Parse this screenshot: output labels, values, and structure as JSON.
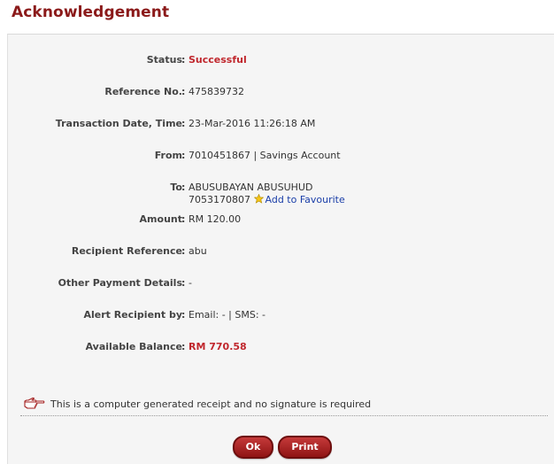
{
  "page": {
    "title": "Acknowledgement"
  },
  "colon": ":",
  "fields": {
    "status": {
      "label": "Status",
      "value": "Successful"
    },
    "reference_no": {
      "label": "Reference No.",
      "value": "475839732"
    },
    "transaction_date": {
      "label": "Transaction Date, Time",
      "value": "23-Mar-2016 11:26:18 AM"
    },
    "from": {
      "label": "From",
      "value": "7010451867 | Savings Account"
    },
    "to": {
      "label": "To",
      "name": "ABUSUBAYAN ABUSUHUD",
      "account": "7053170807",
      "favourite_link": "Add to Favourite",
      "favourite_icon": "star-icon"
    },
    "amount": {
      "label": "Amount",
      "value": "RM 120.00"
    },
    "recipient_reference": {
      "label": "Recipient Reference",
      "value": "abu"
    },
    "other_payment_details": {
      "label": "Other Payment Details",
      "value": "-"
    },
    "alert_recipient": {
      "label": "Alert Recipient by",
      "value": "Email: - | SMS: -"
    },
    "available_balance": {
      "label": "Available Balance",
      "value": "RM 770.58"
    }
  },
  "note": {
    "icon": "pointing-hand-icon",
    "text": "This is a computer generated receipt and no signature is required"
  },
  "buttons": {
    "ok": "Ok",
    "print": "Print"
  },
  "colors": {
    "title": "#8b1a1a",
    "status": "#c0272d",
    "link": "#1a3ea8",
    "button": "#a31f1f"
  }
}
